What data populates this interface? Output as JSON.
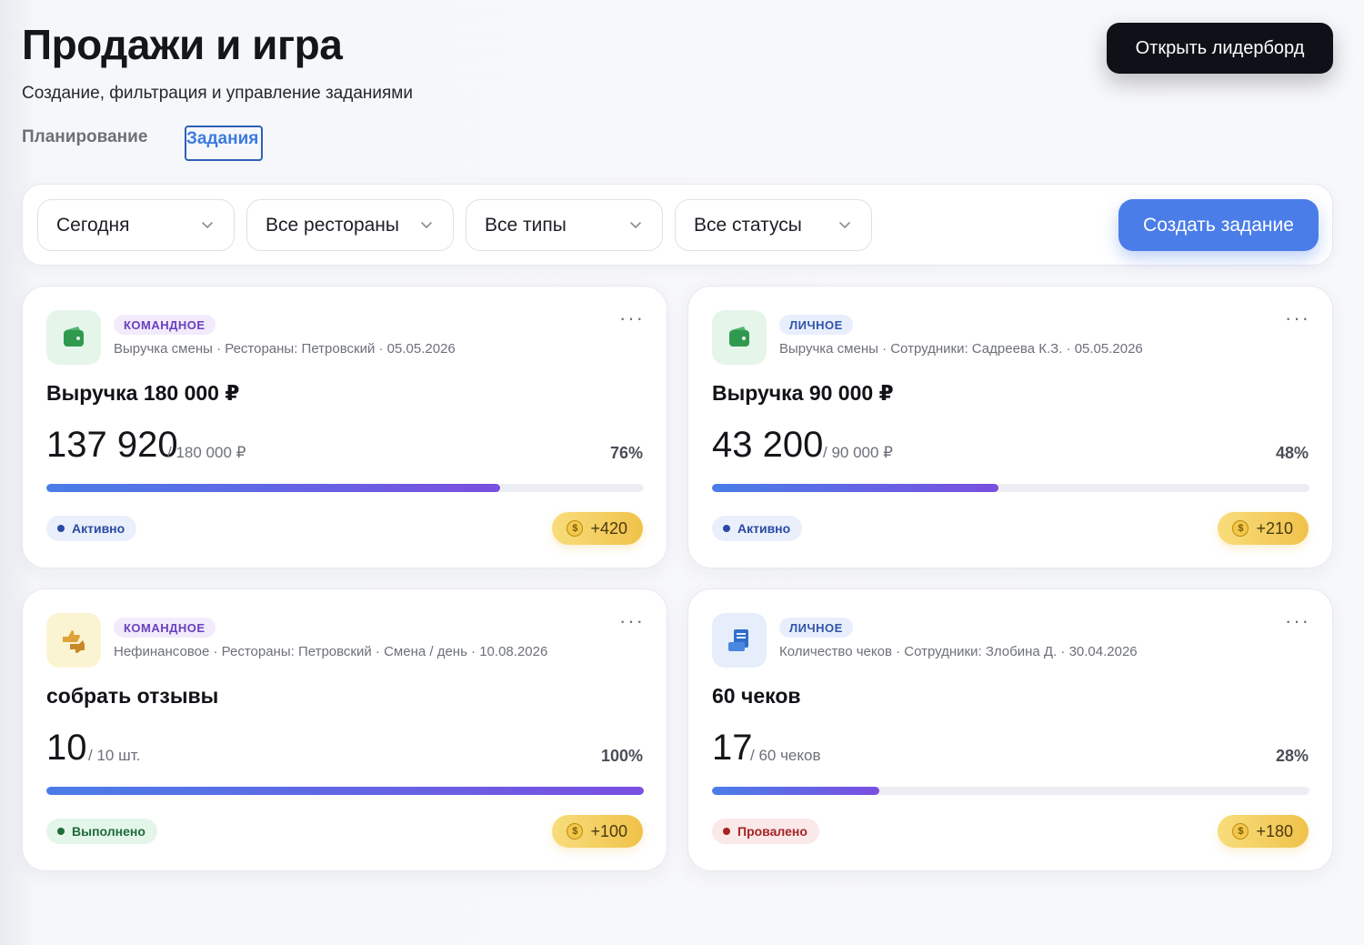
{
  "header": {
    "title": "Продажи и игра",
    "subtitle": "Создание, фильтрация и управление заданиями",
    "leaderboard_button": "Открыть лидерборд"
  },
  "tabs": [
    {
      "label": "Планирование",
      "active": false
    },
    {
      "label": "Задания",
      "active": true
    }
  ],
  "filters": {
    "date": "Сегодня",
    "restaurants": "Все рестораны",
    "types": "Все типы",
    "statuses": "Все статусы",
    "create_button": "Создать задание"
  },
  "cards": [
    {
      "type": "КОМАНДНОЕ",
      "meta": "Выручка смены · Рестораны: Петровский · 05.05.2026",
      "name": "Выручка 180 000 ₽",
      "current": "137 920",
      "target": "/ 180 000 ₽",
      "percent": "76%",
      "progress": 0.76,
      "status": "Активно",
      "reward": "+420",
      "icon": "wallet-icon"
    },
    {
      "type": "ЛИЧНОЕ",
      "meta": "Выручка смены · Сотрудники: Садреева К.З. · 05.05.2026",
      "name": "Выручка 90 000 ₽",
      "current": "43 200",
      "target": "/ 90 000 ₽",
      "percent": "48%",
      "progress": 0.48,
      "status": "Активно",
      "reward": "+210",
      "icon": "wallet-icon"
    },
    {
      "type": "КОМАНДНОЕ",
      "meta": "Нефинансовое · Рестораны: Петровский · Смена / день · 10.08.2026",
      "name": "собрать отзывы",
      "current": "10",
      "target": "/ 10 шт.",
      "percent": "100%",
      "progress": 1.0,
      "status": "Выполнено",
      "reward": "+100",
      "icon": "thumbs-icon"
    },
    {
      "type": "ЛИЧНОЕ",
      "meta": "Количество чеков · Сотрудники: Злобина Д. · 30.04.2026",
      "name": "60 чеков",
      "current": "17",
      "target": "/ 60 чеков",
      "percent": "28%",
      "progress": 0.28,
      "status": "Провалено",
      "reward": "+180",
      "icon": "receipt-icon"
    }
  ],
  "coin_symbol": "$",
  "menu_glyph": "···",
  "colors": {
    "accent": "#4a7de8",
    "dark_button": "#0f1118",
    "progress_start": "#4a7de8",
    "progress_end": "#7a4fe0",
    "reward": "#f0c24a"
  }
}
